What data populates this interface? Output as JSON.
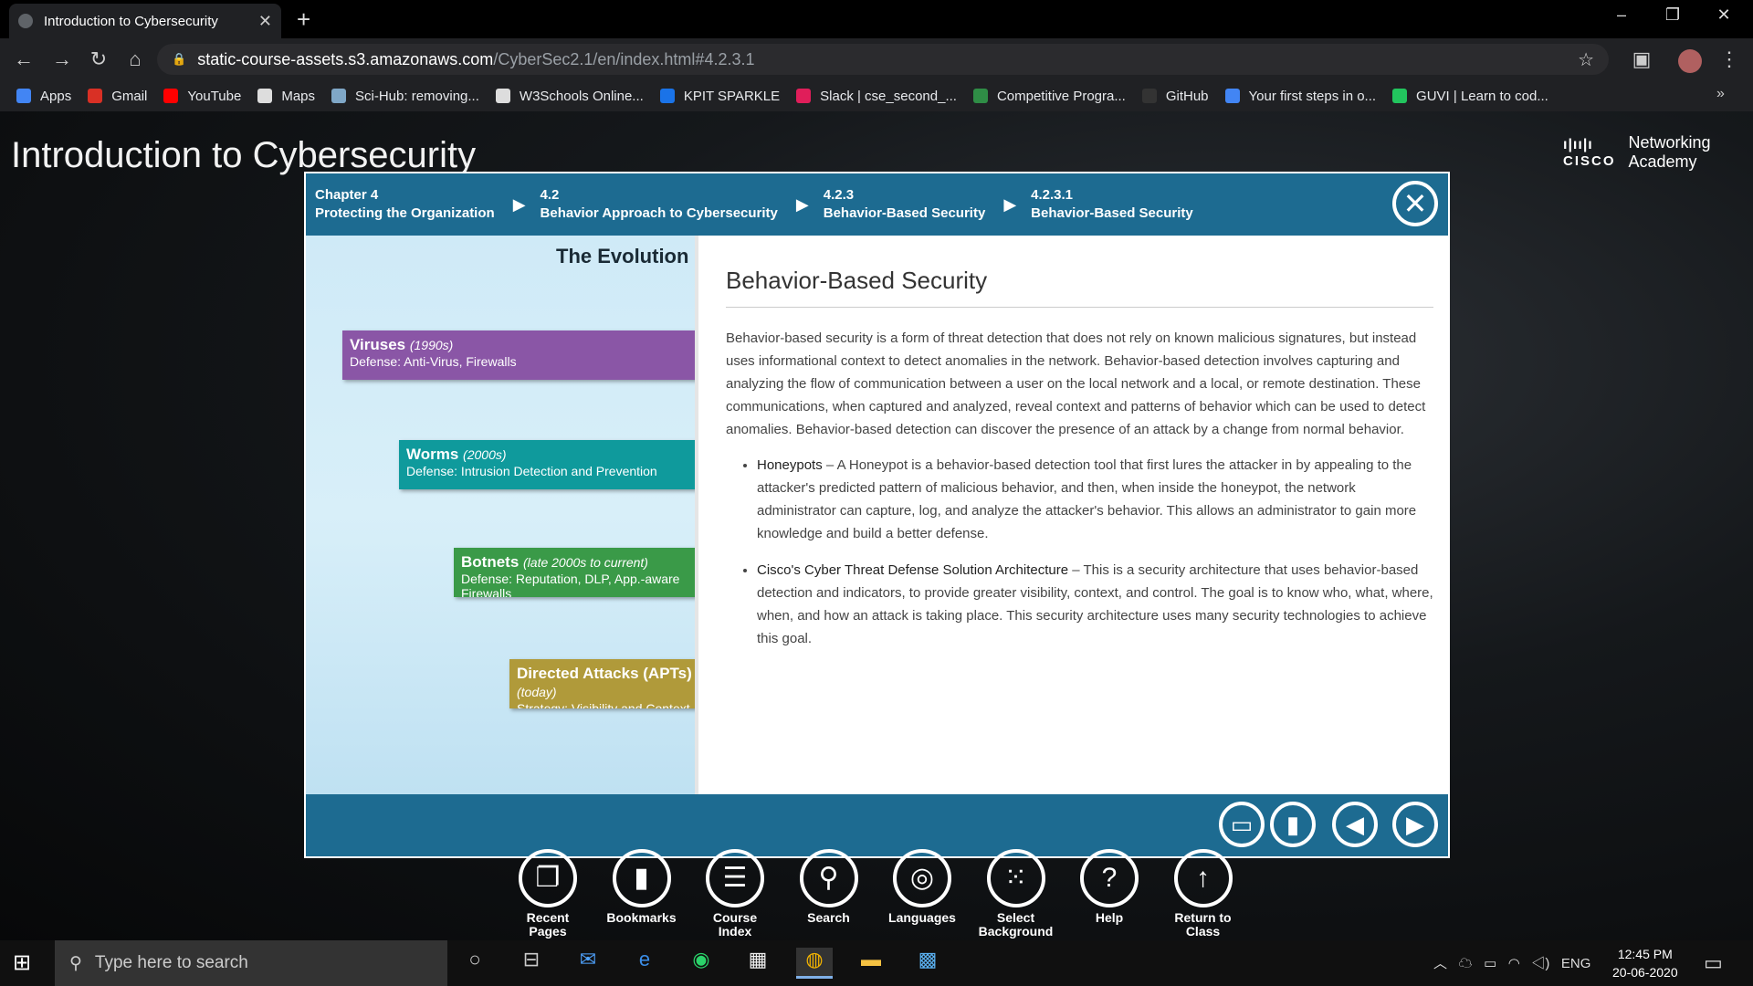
{
  "browser": {
    "tab_title": "Introduction to Cybersecurity",
    "url_host": "static-course-assets.s3.amazonaws.com",
    "url_path": "/CyberSec2.1/en/index.html#4.2.3.1",
    "bookmarks": [
      {
        "label": "Apps",
        "color": "#4285f4"
      },
      {
        "label": "Gmail",
        "color": "#d93025"
      },
      {
        "label": "YouTube",
        "color": "#ff0000"
      },
      {
        "label": "Maps",
        "color": "#dddddd"
      },
      {
        "label": "Sci-Hub: removing...",
        "color": "#7fa7c7"
      },
      {
        "label": "W3Schools Online...",
        "color": "#dddddd"
      },
      {
        "label": "KPIT SPARKLE",
        "color": "#1a73e8"
      },
      {
        "label": "Slack | cse_second_...",
        "color": "#e01e5a"
      },
      {
        "label": "Competitive Progra...",
        "color": "#2f8d46"
      },
      {
        "label": "GitHub",
        "color": "#333333"
      },
      {
        "label": "Your first steps in o...",
        "color": "#4285f4"
      },
      {
        "label": "GUVI | Learn to cod...",
        "color": "#22c55e"
      }
    ]
  },
  "course": {
    "title": "Introduction to Cybersecurity",
    "brand_line1": "Networking",
    "brand_line2": "Academy",
    "brand_logo": "cisco"
  },
  "breadcrumb": [
    {
      "num": "Chapter 4",
      "label": "Protecting the Organization"
    },
    {
      "num": "4.2",
      "label": "Behavior Approach to Cybersecurity"
    },
    {
      "num": "4.2.3",
      "label": "Behavior-Based Security"
    },
    {
      "num": "4.2.3.1",
      "label": "Behavior-Based Security"
    }
  ],
  "figure": {
    "title": "The Evolution of Cyber Threats",
    "threats": [
      {
        "name": "Viruses",
        "era": "(1990s)",
        "desc": "Defense: Anti-Virus, Firewalls",
        "color": "#8a56a6"
      },
      {
        "name": "Worms",
        "era": "(2000s)",
        "desc": "Defense: Intrusion Detection and Prevention",
        "color": "#0f9a9c"
      },
      {
        "name": "Botnets",
        "era": "(late 2000s to current)",
        "desc": "Defense: Reputation, DLP, App.-aware Firewalls",
        "color": "#3a9a48"
      },
      {
        "name": "Directed Attacks (APTs)",
        "era": "(today)",
        "desc": "Strategy: Visibility and Context",
        "color": "#b09a3a"
      }
    ]
  },
  "article": {
    "title": "Behavior-Based Security",
    "intro": "Behavior-based security is a form of threat detection that does not rely on known malicious signatures, but instead uses informational context to detect anomalies in the network. Behavior-based detection involves capturing and analyzing the flow of communication between a user on the local network and a local, or remote destination. These communications, when captured and analyzed, reveal context and patterns of behavior which can be used to detect anomalies. Behavior-based detection can discover the presence of an attack by a change from normal behavior.",
    "bullets": [
      {
        "term": "Honeypots",
        "text": " – A Honeypot is a behavior-based detection tool that first lures the attacker in by appealing to the attacker's predicted pattern of malicious behavior, and then, when inside the honeypot, the network administrator can capture, log, and analyze the attacker's behavior. This allows an administrator to gain more knowledge and build a better defense."
      },
      {
        "term": "Cisco's Cyber Threat Defense Solution Architecture",
        "text": " – This is a security architecture that uses behavior-based detection and indicators, to provide greater visibility, context, and control. The goal is to know who, what, where, when, and how an attack is taking place. This security architecture uses many security technologies to achieve this goal."
      }
    ]
  },
  "menu": [
    {
      "l1": "Recent",
      "l2": "Pages",
      "icon": "recent-pages-icon",
      "glyph": "❐"
    },
    {
      "l1": "Bookmarks",
      "l2": "",
      "icon": "bookmark-icon",
      "glyph": "▮"
    },
    {
      "l1": "Course",
      "l2": "Index",
      "icon": "menu-list-icon",
      "glyph": "☰"
    },
    {
      "l1": "Search",
      "l2": "",
      "icon": "search-icon",
      "glyph": "⚲"
    },
    {
      "l1": "Languages",
      "l2": "",
      "icon": "globe-icon",
      "glyph": "◎"
    },
    {
      "l1": "Select",
      "l2": "Background",
      "icon": "grid-icon",
      "glyph": "⁙"
    },
    {
      "l1": "Help",
      "l2": "",
      "icon": "help-icon",
      "glyph": "?"
    },
    {
      "l1": "Return to",
      "l2": "Class",
      "icon": "arrow-up-icon",
      "glyph": "↑"
    }
  ],
  "taskbar": {
    "search_placeholder": "Type here to search",
    "lang": "ENG",
    "time": "12:45 PM",
    "date": "20-06-2020"
  }
}
